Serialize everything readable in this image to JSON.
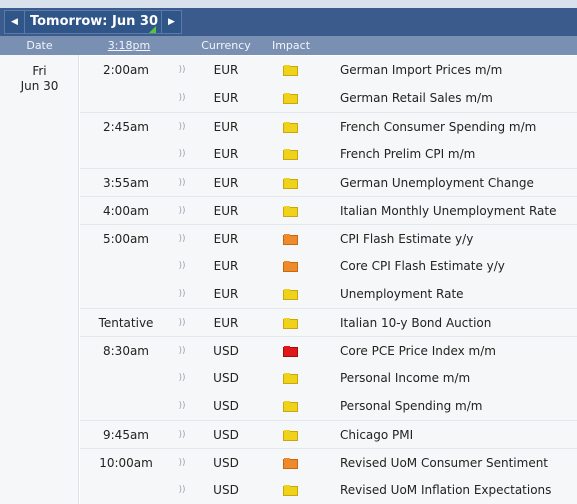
{
  "nav": {
    "prev": "◀",
    "title": "Tomorrow: Jun 30",
    "next": "▶"
  },
  "columns": {
    "date": "Date",
    "time": "3:18pm",
    "currency": "Currency",
    "impact": "Impact"
  },
  "date": {
    "day": "Fri",
    "num": "Jun 30"
  },
  "impact_colors": {
    "low": "#f0d21a",
    "medium": "#ef8a2a",
    "high": "#e01818"
  },
  "events": [
    {
      "time": "2:00am",
      "currency": "EUR",
      "impact": "low",
      "event": "German Import Prices m/m",
      "current": true
    },
    {
      "time": "",
      "currency": "EUR",
      "impact": "low",
      "event": "German Retail Sales m/m"
    },
    {
      "time": "2:45am",
      "currency": "EUR",
      "impact": "low",
      "event": "French Consumer Spending m/m"
    },
    {
      "time": "",
      "currency": "EUR",
      "impact": "low",
      "event": "French Prelim CPI m/m"
    },
    {
      "time": "3:55am",
      "currency": "EUR",
      "impact": "low",
      "event": "German Unemployment Change"
    },
    {
      "time": "4:00am",
      "currency": "EUR",
      "impact": "low",
      "event": "Italian Monthly Unemployment Rate"
    },
    {
      "time": "5:00am",
      "currency": "EUR",
      "impact": "medium",
      "event": "CPI Flash Estimate y/y"
    },
    {
      "time": "",
      "currency": "EUR",
      "impact": "medium",
      "event": "Core CPI Flash Estimate y/y"
    },
    {
      "time": "",
      "currency": "EUR",
      "impact": "low",
      "event": "Unemployment Rate"
    },
    {
      "time": "Tentative",
      "currency": "EUR",
      "impact": "low",
      "event": "Italian 10-y Bond Auction"
    },
    {
      "time": "8:30am",
      "currency": "USD",
      "impact": "high",
      "event": "Core PCE Price Index m/m"
    },
    {
      "time": "",
      "currency": "USD",
      "impact": "low",
      "event": "Personal Income m/m"
    },
    {
      "time": "",
      "currency": "USD",
      "impact": "low",
      "event": "Personal Spending m/m"
    },
    {
      "time": "9:45am",
      "currency": "USD",
      "impact": "low",
      "event": "Chicago PMI"
    },
    {
      "time": "10:00am",
      "currency": "USD",
      "impact": "medium",
      "event": "Revised UoM Consumer Sentiment"
    },
    {
      "time": "",
      "currency": "USD",
      "impact": "low",
      "event": "Revised UoM Inflation Expectations"
    }
  ]
}
